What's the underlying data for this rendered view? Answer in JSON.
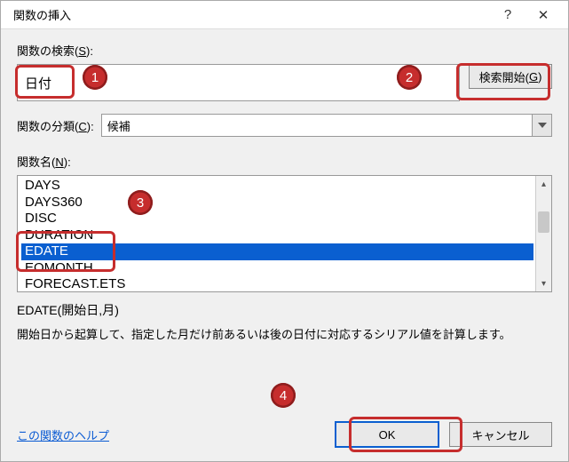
{
  "titlebar": {
    "title": "関数の挿入"
  },
  "search": {
    "label_prefix": "関数の検索(",
    "label_access": "S",
    "label_suffix": "):",
    "value": "日付",
    "button_prefix": "検索開始(",
    "button_access": "G",
    "button_suffix": ")"
  },
  "category": {
    "label_prefix": "関数の分類(",
    "label_access": "C",
    "label_suffix": "):",
    "value": "候補"
  },
  "funclist": {
    "label_prefix": "関数名(",
    "label_access": "N",
    "label_suffix": "):",
    "items": [
      "DAYS",
      "DAYS360",
      "DISC",
      "DURATION",
      "EDATE",
      "EOMONTH",
      "FORECAST.ETS"
    ],
    "selected_index": 4
  },
  "detail": {
    "signature": "EDATE(開始日,月)",
    "description": "開始日から起算して、指定した月だけ前あるいは後の日付に対応するシリアル値を計算します。"
  },
  "footer": {
    "help": "この関数のヘルプ",
    "ok": "OK",
    "cancel": "キャンセル"
  },
  "annotations": {
    "c1": "1",
    "c2": "2",
    "c3": "3",
    "c4": "4"
  }
}
